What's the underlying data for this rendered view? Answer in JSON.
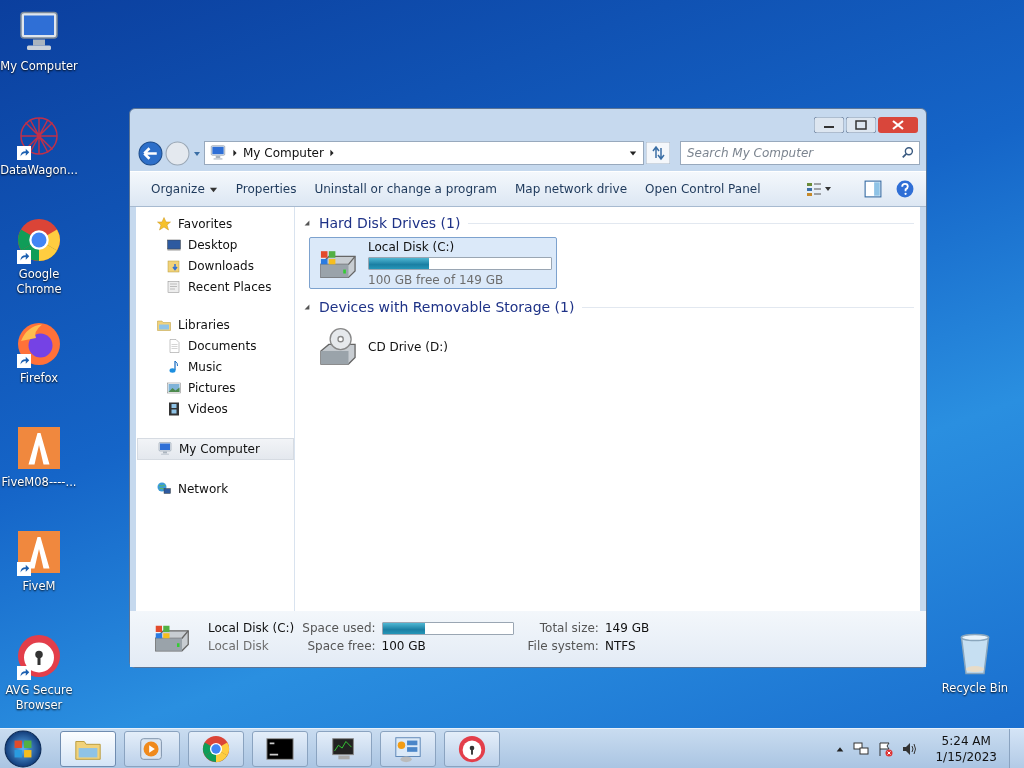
{
  "desktop_icons": [
    {
      "label": "My Computer",
      "kind": "computer",
      "shortcut": false
    },
    {
      "label": "DataWagon...",
      "kind": "datawagon",
      "shortcut": true
    },
    {
      "label": "Google Chrome",
      "kind": "chrome",
      "shortcut": true
    },
    {
      "label": "Firefox",
      "kind": "firefox",
      "shortcut": true
    },
    {
      "label": "FiveM08----...",
      "kind": "fivem",
      "shortcut": false
    },
    {
      "label": "FiveM",
      "kind": "fivem",
      "shortcut": true
    },
    {
      "label": "AVG Secure Browser",
      "kind": "avg",
      "shortcut": true
    }
  ],
  "recycle_bin": {
    "label": "Recycle Bin"
  },
  "window": {
    "address": {
      "crumbs": [
        "My Computer"
      ]
    },
    "search": {
      "placeholder": "Search My Computer"
    },
    "toolbar": [
      {
        "label": "Organize",
        "kind": "menu"
      },
      {
        "label": "Properties",
        "kind": "plain"
      },
      {
        "label": "Uninstall or change a program",
        "kind": "plain"
      },
      {
        "label": "Map network drive",
        "kind": "plain"
      },
      {
        "label": "Open Control Panel",
        "kind": "plain"
      }
    ],
    "nav": [
      {
        "label": "Favorites",
        "kind": "star",
        "selected": false,
        "children": [
          {
            "label": "Desktop",
            "kind": "desktop",
            "selected": false
          },
          {
            "label": "Downloads",
            "kind": "downloads",
            "selected": false
          },
          {
            "label": "Recent Places",
            "kind": "recent",
            "selected": false
          }
        ]
      },
      {
        "label": "Libraries",
        "kind": "library",
        "selected": false,
        "children": [
          {
            "label": "Documents",
            "kind": "document",
            "selected": false
          },
          {
            "label": "Music",
            "kind": "music",
            "selected": false
          },
          {
            "label": "Pictures",
            "kind": "pictures",
            "selected": false
          },
          {
            "label": "Videos",
            "kind": "videos",
            "selected": false
          }
        ]
      },
      {
        "label": "My Computer",
        "kind": "computer",
        "selected": true
      },
      {
        "label": "Network",
        "kind": "network",
        "selected": false
      }
    ],
    "groups": [
      {
        "title": "Hard Disk Drives (1)",
        "expanded": true,
        "items": [
          {
            "name": "Local Disk (C:)",
            "kind": "disk",
            "level": 0.33,
            "detail": "100 GB free of 149 GB",
            "selected": true
          }
        ]
      },
      {
        "title": "Devices with Removable Storage (1)",
        "expanded": true,
        "items": [
          {
            "name": "CD Drive (D:)",
            "kind": "cd",
            "selected": false
          }
        ]
      }
    ],
    "details": {
      "name": "Local Disk (C:)",
      "type": "Local Disk",
      "used_label": "Space used:",
      "level": 0.33,
      "free_label": "Space free:",
      "free_value": "100 GB",
      "total_label": "Total size:",
      "total_value": "149 GB",
      "fs_label": "File system:",
      "fs_value": "NTFS"
    }
  },
  "taskbar": {
    "apps": [
      {
        "kind": "explorer",
        "selected": true
      },
      {
        "kind": "media"
      },
      {
        "kind": "chrome"
      },
      {
        "kind": "cmd"
      },
      {
        "kind": "monitor"
      },
      {
        "kind": "control"
      },
      {
        "kind": "avg"
      }
    ],
    "time": "5:24 AM",
    "date": "1/15/2023"
  }
}
